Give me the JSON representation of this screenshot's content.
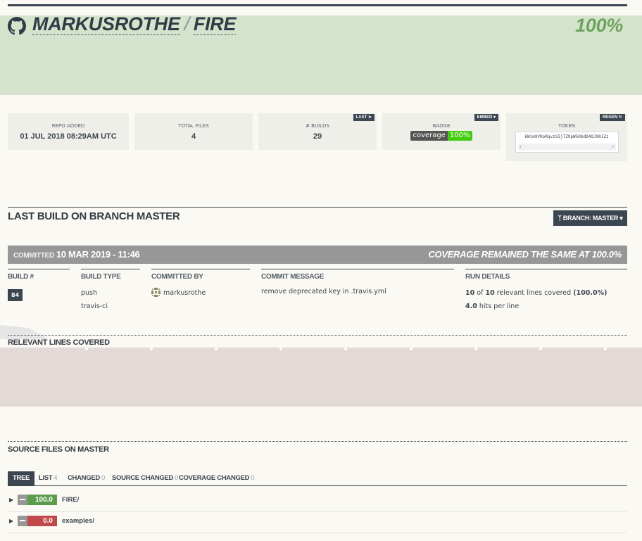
{
  "header": {
    "owner": "MARKUSROTHE",
    "separator": "/",
    "repo": "FIRE",
    "coverage": "100%"
  },
  "stats": {
    "repo_added": {
      "label": "REPO ADDED",
      "value": "01 JUL 2018 08:29AM UTC"
    },
    "total_files": {
      "label": "TOTAL FILES",
      "value": "4"
    },
    "builds": {
      "label": "# BUILDS",
      "value": "29",
      "button": "LAST"
    },
    "badge": {
      "label": "BADGE",
      "button": "EMBED",
      "left": "coverage",
      "right": "100%"
    },
    "token": {
      "label": "TOKEN",
      "button": "REGEN",
      "value": "6Wim9VRoRqvzS5jTZ9pW50bdD4OJ901Zz"
    }
  },
  "last_build": {
    "title": "LAST BUILD ON BRANCH MASTER",
    "branch_button": "BRANCH: MASTER",
    "committed_prefix": "COMMITTED",
    "committed_date": "10 MAR 2019 - 11:46",
    "coverage_status": "COVERAGE REMAINED THE SAME AT 100.0%",
    "columns": {
      "build_num": {
        "header": "BUILD #",
        "value": "84"
      },
      "build_type": {
        "header": "BUILD TYPE",
        "line1": "push",
        "line2": "travis-ci"
      },
      "committed_by": {
        "header": "COMMITTED BY",
        "value": "markusrothe"
      },
      "commit_message": {
        "header": "COMMIT MESSAGE",
        "value": "remove deprecated key in .travis.yml"
      },
      "run_details": {
        "header": "RUN DETAILS",
        "covered": "10",
        "of": "of",
        "total": "10",
        "relevant_text": "relevant lines covered",
        "pct": "(100.0%)",
        "hits": "4.0",
        "hits_text": "hits per line"
      }
    }
  },
  "relevant_lines": {
    "title": "RELEVANT LINES COVERED"
  },
  "source_files": {
    "title": "SOURCE FILES ON MASTER",
    "tabs": [
      {
        "label": "TREE",
        "count": ""
      },
      {
        "label": "LIST",
        "count": "4"
      },
      {
        "label": "CHANGED",
        "count": "0"
      },
      {
        "label": "SOURCE CHANGED",
        "count": "0"
      },
      {
        "label": "COVERAGE CHANGED",
        "count": "0"
      }
    ],
    "files": [
      {
        "coverage": "100.0",
        "name": "FIRE/",
        "color": "#5c9c4c"
      },
      {
        "coverage": "0.0",
        "name": "examples/",
        "color": "#c0494b"
      }
    ]
  },
  "colors": {
    "header_band": "#d5e3cd",
    "relevant_band": "#e3dad7",
    "dark": "#3c4650",
    "coverage_green": "#6ea35e"
  }
}
